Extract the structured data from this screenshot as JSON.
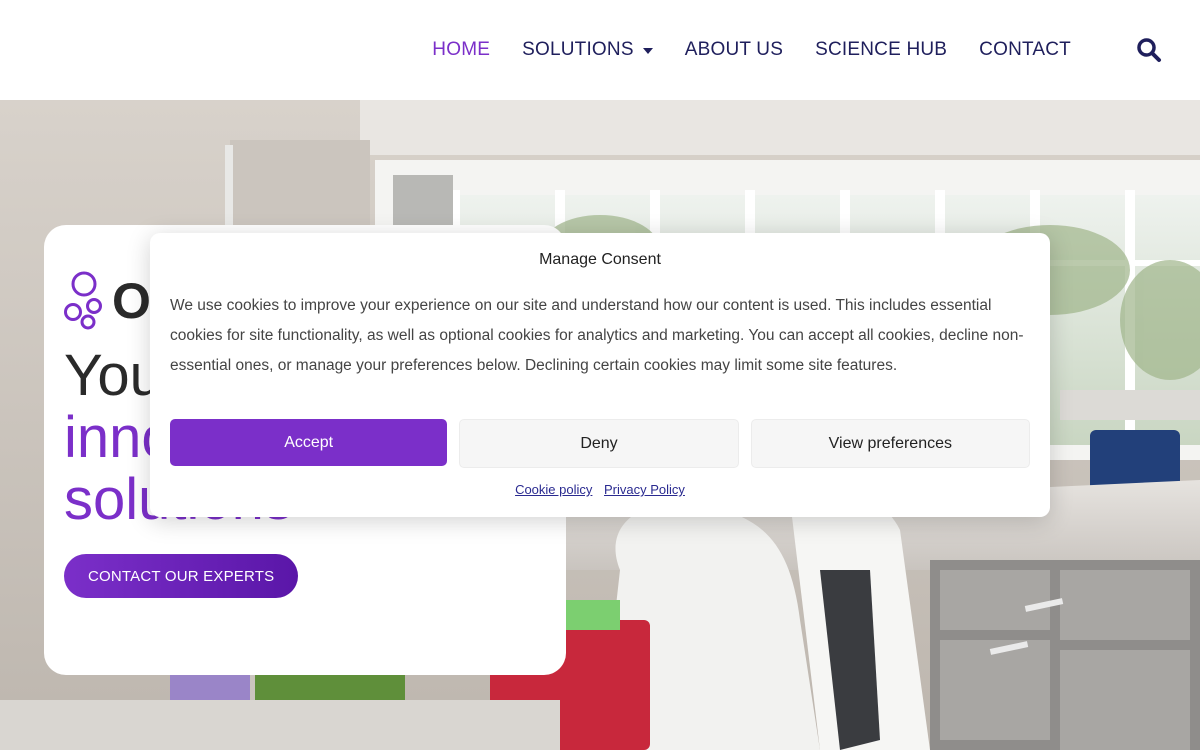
{
  "nav": {
    "items": [
      {
        "label": "HOME",
        "active": true
      },
      {
        "label": "SOLUTIONS",
        "has_dropdown": true
      },
      {
        "label": "ABOUT US"
      },
      {
        "label": "SCIENCE HUB"
      },
      {
        "label": "CONTACT"
      }
    ],
    "search_icon": "search-icon"
  },
  "hero": {
    "logo_text": "Ol",
    "headline_line1": "You",
    "headline_line2": "inno",
    "headline_line3": "solutions",
    "cta_label": "CONTACT OUR EXPERTS"
  },
  "consent": {
    "title": "Manage Consent",
    "body": "We use cookies to improve your experience on our site and understand how our content is used. This includes essential cookies for site functionality, as well as optional cookies for analytics and marketing. You can accept all cookies, decline non-essential ones, or manage your preferences below. Declining certain cookies may limit some site features.",
    "accept_label": "Accept",
    "deny_label": "Deny",
    "prefs_label": "View preferences",
    "cookie_policy_label": "Cookie policy",
    "privacy_policy_label": "Privacy Policy"
  },
  "colors": {
    "accent": "#7b2fc9",
    "nav_text": "#1f1f5c"
  }
}
